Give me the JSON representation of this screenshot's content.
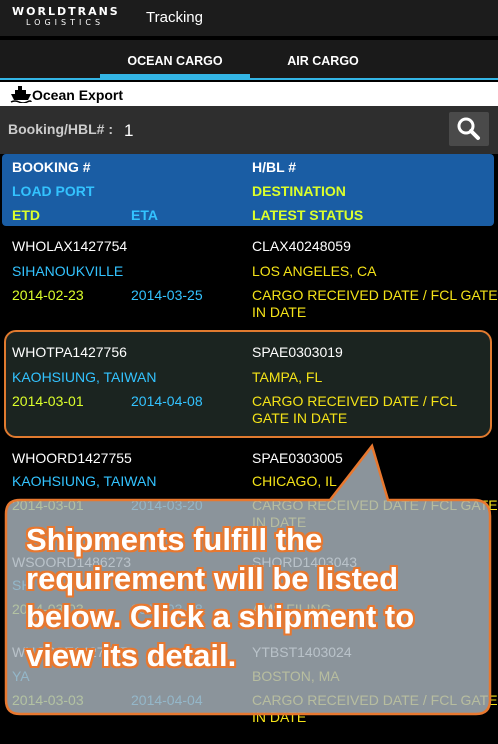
{
  "app": {
    "logo_top": "WORLDTRANS",
    "logo_bottom": "LOGISTICS",
    "title": "Tracking"
  },
  "tabs": [
    {
      "label": "OCEAN CARGO"
    },
    {
      "label": "AIR CARGO"
    }
  ],
  "section": {
    "title": "Ocean Export"
  },
  "search": {
    "label": "Booking/HBL# :",
    "value": "1"
  },
  "table_header": {
    "booking": "BOOKING #",
    "hbl": "H/BL #",
    "load_port": "LOAD PORT",
    "destination": "DESTINATION",
    "etd": "ETD",
    "eta": "ETA",
    "latest_status": "LATEST STATUS"
  },
  "shipments": [
    {
      "booking": "WHOLAX1427754",
      "hbl": "CLAX40248059",
      "load_port": "SIHANOUKVILLE",
      "destination": "LOS ANGELES, CA",
      "etd": "2014-02-23",
      "eta": "2014-03-25",
      "status": "CARGO RECEIVED DATE / FCL GATE IN DATE"
    },
    {
      "booking": "WHOTPA1427756",
      "hbl": "SPAE0303019",
      "load_port": "KAOHSIUNG, TAIWAN",
      "destination": "TAMPA, FL",
      "etd": "2014-03-01",
      "eta": "2014-04-08",
      "status": "CARGO RECEIVED DATE / FCL GATE IN DATE"
    },
    {
      "booking": "WHOORD1427755",
      "hbl": "SPAE0303005",
      "load_port": "KAOHSIUNG, TAIWAN",
      "destination": "CHICAGO, IL",
      "etd": "2014-03-01",
      "eta": "2014-03-20",
      "status": "CARGO RECEIVED DATE / FCL GATE IN DATE"
    },
    {
      "booking": "WSOORD1486273",
      "hbl": "SHORD1403043",
      "load_port": "SH",
      "destination": "",
      "etd": "2014-03-03",
      "eta": "2014-03-28",
      "status": "AMS FILING"
    },
    {
      "booking": "WHOBST1427757",
      "hbl": "YTBST1403024",
      "load_port": "YA",
      "destination": "BOSTON, MA",
      "etd": "2014-03-03",
      "eta": "2014-04-04",
      "status": "CARGO RECEIVED DATE / FCL GATE IN DATE"
    }
  ],
  "callout": {
    "text": "Shipments fulfill the requirement will be listed below. Click a shipment to view its detail."
  },
  "colors": {
    "accent": "#33b5e5",
    "header_bg": "#1a5da4",
    "callout_fill": "#a9b4bd",
    "callout_border": "#e8782f"
  }
}
